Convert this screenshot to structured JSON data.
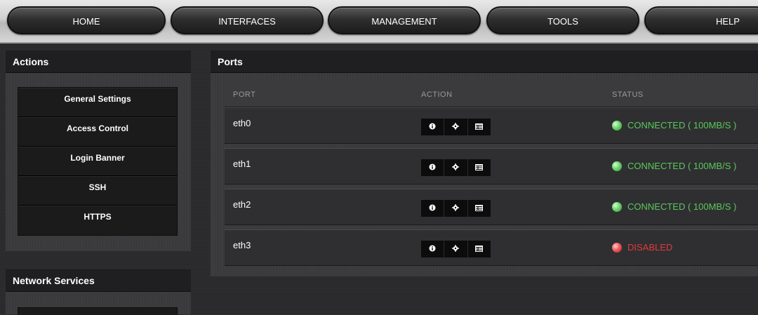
{
  "nav": {
    "home": "HOME",
    "interfaces": "INTERFACES",
    "management": "MANAGEMENT",
    "tools": "TOOLS",
    "help": "HELP"
  },
  "actions_panel": {
    "title": "Actions",
    "items": [
      "General Settings",
      "Access Control",
      "Login Banner",
      "SSH",
      "HTTPS"
    ]
  },
  "network_services_panel": {
    "title": "Network Services"
  },
  "ports_panel": {
    "title": "Ports",
    "columns": [
      "PORT",
      "ACTION",
      "STATUS"
    ],
    "rows": [
      {
        "port": "eth0",
        "status": "CONNECTED ( 100MB/S )",
        "state": "connected"
      },
      {
        "port": "eth1",
        "status": "CONNECTED ( 100MB/S )",
        "state": "connected"
      },
      {
        "port": "eth2",
        "status": "CONNECTED ( 100MB/S )",
        "state": "connected"
      },
      {
        "port": "eth3",
        "status": "DISABLED",
        "state": "disabled"
      }
    ],
    "action_icons": [
      "info-icon",
      "gear-icon",
      "table-icon"
    ]
  },
  "colors": {
    "connected": "#5ac85a",
    "disabled": "#e03a3a"
  }
}
